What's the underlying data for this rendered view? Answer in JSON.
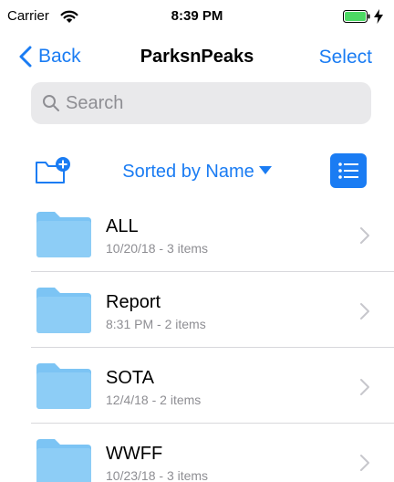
{
  "status_bar": {
    "carrier": "Carrier",
    "time": "8:39 PM"
  },
  "nav": {
    "back_label": "Back",
    "title": "ParksnPeaks",
    "select_label": "Select"
  },
  "search": {
    "placeholder": "Search"
  },
  "toolbar": {
    "sort_label": "Sorted by Name"
  },
  "colors": {
    "accent": "#1a7cf3",
    "folder": "#7cc4f4",
    "battery": "#4cd964",
    "secondary_text": "#8e8e93"
  },
  "folders": [
    {
      "name": "ALL",
      "meta": "10/20/18 - 3 items"
    },
    {
      "name": "Report",
      "meta": "8:31 PM - 2 items"
    },
    {
      "name": "SOTA",
      "meta": "12/4/18 - 2 items"
    },
    {
      "name": "WWFF",
      "meta": "10/23/18 - 3 items"
    }
  ]
}
